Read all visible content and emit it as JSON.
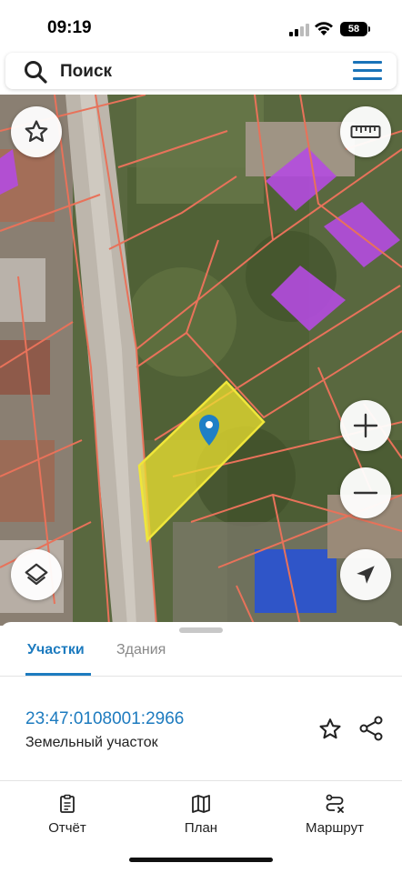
{
  "status_bar": {
    "time": "09:19",
    "battery": "58"
  },
  "search": {
    "label": "Поиск",
    "search_icon": "search-icon",
    "menu_icon": "hamburger-menu-icon"
  },
  "map": {
    "buttons": {
      "favorite": "star-icon",
      "ruler": "ruler-icon",
      "zoom_in": "plus-icon",
      "zoom_out": "minus-icon",
      "layers": "layers-icon",
      "location": "navigation-arrow-icon"
    },
    "colors": {
      "parcel_border": "#e8725a",
      "selected_parcel": "#ece22f",
      "building": "#b44be0",
      "marker": "#1e7fc6"
    }
  },
  "sheet": {
    "tabs": [
      {
        "label": "Участки",
        "active": true
      },
      {
        "label": "Здания",
        "active": false
      }
    ],
    "parcel": {
      "cadastral_number": "23:47:0108001:2966",
      "type": "Земельный участок"
    },
    "actions": {
      "favorite_icon": "star-outline-icon",
      "share_icon": "share-icon"
    },
    "bottom_nav": [
      {
        "label": "Отчёт",
        "icon": "clipboard-icon"
      },
      {
        "label": "План",
        "icon": "map-icon"
      },
      {
        "label": "Маршрут",
        "icon": "route-icon"
      }
    ],
    "accent_color": "#1d7bbf"
  }
}
